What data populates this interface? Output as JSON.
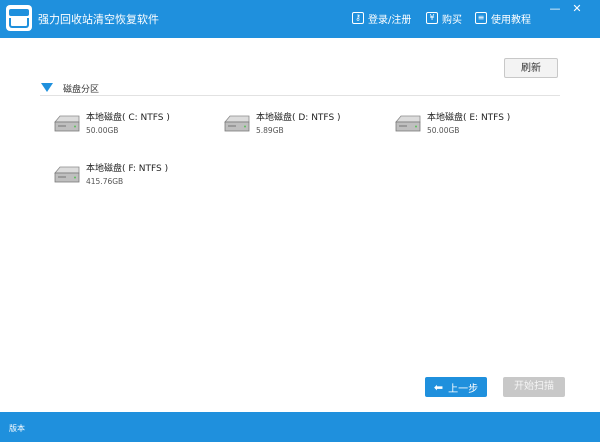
{
  "titlebar": {
    "app_title": "强力回收站清空恢复软件",
    "login_label": "登录/注册",
    "buy_label": "购买",
    "help_label": "使用教程",
    "minimize_glyph": "—",
    "close_glyph": "✕"
  },
  "section": {
    "title": "磁盘分区",
    "refresh_label": "刷新"
  },
  "disks": [
    {
      "name": "本地磁盘( C: NTFS )",
      "size": "50.00GB"
    },
    {
      "name": "本地磁盘( D: NTFS )",
      "size": "5.89GB"
    },
    {
      "name": "本地磁盘( E: NTFS )",
      "size": "50.00GB"
    },
    {
      "name": "本地磁盘( F: NTFS )",
      "size": "415.76GB"
    }
  ],
  "buttons": {
    "prev_label": "上一步",
    "start_label": "开始扫描"
  },
  "footer": {
    "label": "版本"
  },
  "colors": {
    "accent": "#1f90dd",
    "disabled": "#c8c8c8"
  },
  "icons": [
    "app-logo-icon",
    "key-icon",
    "yen-icon",
    "book-icon",
    "disk-drive-icon",
    "back-arrow-icon"
  ]
}
